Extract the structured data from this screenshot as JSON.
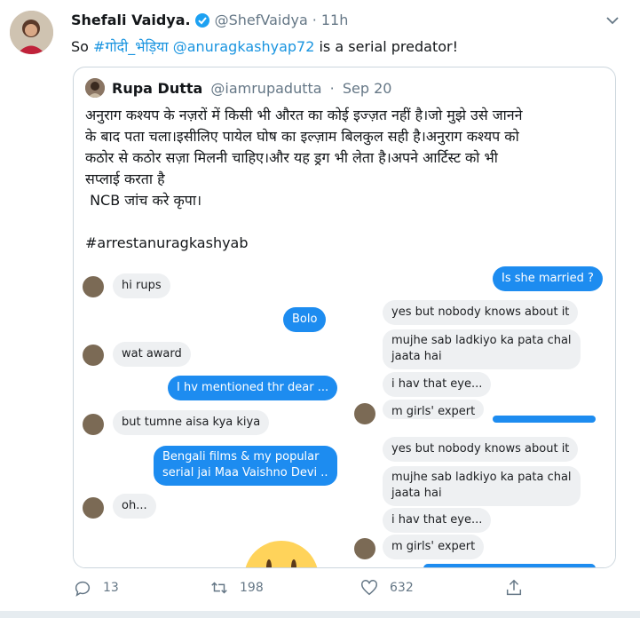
{
  "tweet": {
    "display_name": "Shefali Vaidya.",
    "handle": "@ShefVaidya",
    "separator": "·",
    "time": "11h",
    "text_prefix": "So ",
    "hashtag": "#गोदी_भेड़िया",
    "mention": "@anuragkashyap72",
    "text_suffix": " is a serial predator!"
  },
  "quote": {
    "display_name": "Rupa Dutta",
    "handle": "@iamrupadutta",
    "separator": "·",
    "date": "Sep 20",
    "lines": [
      "अनुराग कश्यप के नज़रों में किसी भी औरत का कोई इज्ज़त नहीं है।जो मुझे उसे जानने",
      "के बाद पता चला।इसीलिए पायेल घोष का इल्ज़ाम बिलकुल सही है।अनुराग कश्यप को",
      "कठोर से कठोर सज़ा मिलनी चाहिए।और यह ड्रग भी लेता है।अपने आर्टिस्ट को भी",
      "सप्लाई करता है",
      " NCB जांच करे कृपा।",
      "",
      "#arrestanuragkashyab"
    ]
  },
  "chat": {
    "left": {
      "msg1": "hi rups",
      "msg2": "Bolo",
      "msg3": "wat award",
      "msg4": "I hv mentioned thr dear ...",
      "msg5": "but tumne aisa kya kiya",
      "msg6a": "Bengali films & my popular",
      "msg6b": "serial jai Maa Vaishno Devi ..",
      "msg7": "oh..."
    },
    "right": {
      "top": "Is she married ?",
      "r1": "yes  but nobody knows about it",
      "r2a": "mujhe sab ladkiyo ka pata chal",
      "r2b": "jaata hai",
      "r3": "i hav that eye...",
      "r4": "m girls' expert",
      "r5": "yes  but nobody knows about it",
      "r6a": "mujhe sab ladkiyo ka pata chal",
      "r6b": "jaata hai",
      "r7": "i hav that eye...",
      "r8": "m girls' expert"
    }
  },
  "actions": {
    "reply_count": "13",
    "retweet_count": "198",
    "like_count": "632"
  },
  "colors": {
    "link": "#1b95e0",
    "secondary": "#657786",
    "chat_blue": "#1d8cf0",
    "chat_gray": "#eef0f2"
  }
}
